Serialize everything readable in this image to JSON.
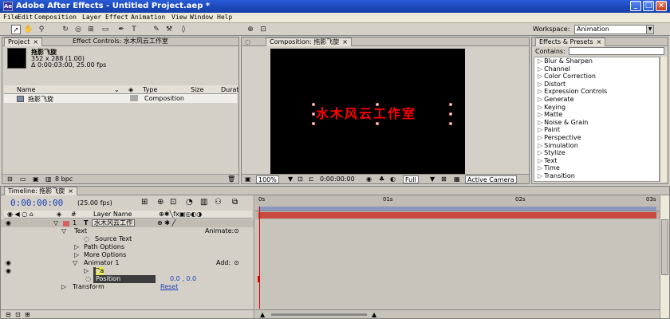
{
  "window": {
    "title": "Adobe After Effects - Untitled Project.aep *",
    "app_icon": "Ae",
    "minimize": "_",
    "maximize": "□",
    "close": "×"
  },
  "menu": [
    "File",
    "Edit",
    "Composition",
    "Layer",
    "Effect",
    "Animation",
    "View",
    "Window",
    "Help"
  ],
  "toolbar": {
    "workspace_label": "Workspace:",
    "workspace_value": "Animation",
    "tools": [
      "selection-tool",
      "hand-tool",
      "zoom-tool",
      "rotation-tool",
      "orbit-camera-tool",
      "pan-behind-tool",
      "rectangle-mask-tool",
      "pen-tool",
      "type-tool",
      "brush-tool",
      "clone-stamp-tool",
      "eraser-tool"
    ]
  },
  "project_panel": {
    "tab_project": "Project",
    "tab_effect_controls": "Effect Controls: 水木风云工作室",
    "item_name": "拖影飞旋",
    "item_size": "352 x 288 (1.00)",
    "item_duration": "Δ 0:00:03:00, 25.00 fps",
    "col_name": "Name",
    "col_type": "Type",
    "col_size": "Size",
    "col_dur": "Durat",
    "row_name": "拖影飞旋",
    "row_type": "Composition",
    "bpc": "8 bpc"
  },
  "comp_panel": {
    "tab": "Composition: 拖影飞旋",
    "title_text": "水木风云工作室",
    "zoom": "100%",
    "timecode": "0:00:00:00",
    "resolution": "Full",
    "camera": "Active Camera"
  },
  "effects_panel": {
    "tab": "Effects & Presets",
    "contains_label": "Contains:",
    "items": [
      "Blur & Sharpen",
      "Channel",
      "Color Correction",
      "Distort",
      "Expression Controls",
      "Generate",
      "Keying",
      "Matte",
      "Noise & Grain",
      "Paint",
      "Perspective",
      "Simulation",
      "Stylize",
      "Text",
      "Time",
      "Transition"
    ]
  },
  "timeline": {
    "tab": "Timeline: 拖影飞旋",
    "timecode": "0:00:00:00",
    "fps": "(25.00 fps)",
    "col_layer_name": "Layer Name",
    "layer_number": "1",
    "layer_name": "水木风云工作",
    "prop_text": "Text",
    "animate_label": "Animate:",
    "prop_source_text": "Source Text",
    "prop_path_options": "Path Options",
    "prop_more_options": "More Options",
    "prop_animator": "Animator 1",
    "add_label": "Add:",
    "prop_range_selector": "Range Selector 1",
    "prop_range_selector_visible": "Ra",
    "prop_range_selector_tail": "e Selector 1",
    "prop_position": "Position",
    "position_value": "0.0 , 0.0",
    "prop_transform": "Transform",
    "reset_label": "Reset",
    "ruler_marks": [
      "0s",
      "01s",
      "02s",
      "03s"
    ]
  }
}
